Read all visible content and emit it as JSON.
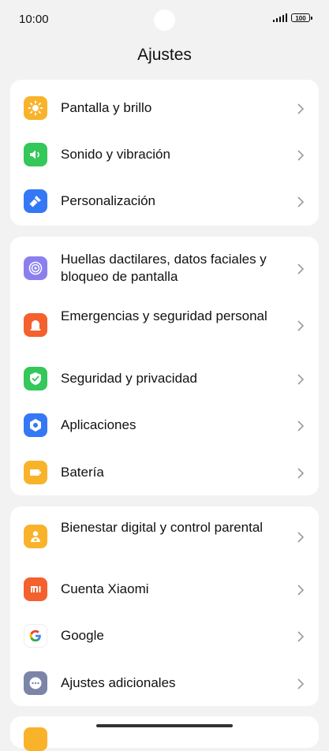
{
  "status_bar": {
    "time": "10:00",
    "battery": "100"
  },
  "title": "Ajustes",
  "groups": [
    {
      "items": [
        {
          "label": "Pantalla y brillo",
          "icon": "sun-icon",
          "color": "#f8b32b"
        },
        {
          "label": "Sonido y vibración",
          "icon": "speaker-icon",
          "color": "#34c759"
        },
        {
          "label": "Personalización",
          "icon": "brush-icon",
          "color": "#3478f6"
        }
      ]
    },
    {
      "items": [
        {
          "label": "Huellas dactilares, datos faciales y bloqueo de pantalla",
          "icon": "fingerprint-icon",
          "color": "#8b7ff0"
        },
        {
          "label": "Emergencias y seguridad personal",
          "icon": "emergency-icon",
          "color": "#f4602e"
        },
        {
          "label": "Seguridad y privacidad",
          "icon": "shield-check-icon",
          "color": "#34c759"
        },
        {
          "label": "Aplicaciones",
          "icon": "apps-icon",
          "color": "#3478f6"
        },
        {
          "label": "Batería",
          "icon": "battery-icon",
          "color": "#f8b32b"
        }
      ]
    },
    {
      "items": [
        {
          "label": "Bienestar digital y control parental",
          "icon": "person-heart-icon",
          "color": "#f8b32b"
        },
        {
          "label": "Cuenta Xiaomi",
          "icon": "mi-icon",
          "color": "#f4602e"
        },
        {
          "label": "Google",
          "icon": "google-icon",
          "color": "#ffffff"
        },
        {
          "label": "Ajustes adicionales",
          "icon": "more-icon",
          "color": "#7c84a8"
        }
      ]
    }
  ]
}
